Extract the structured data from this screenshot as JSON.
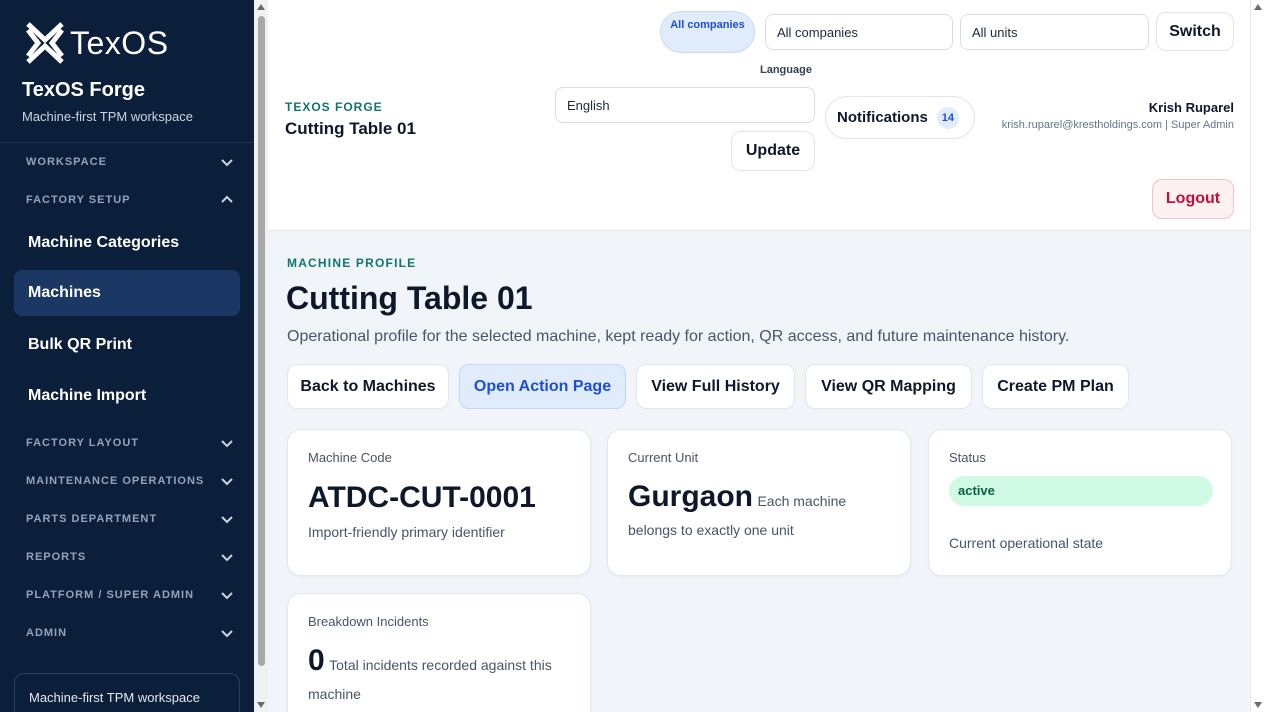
{
  "brand": {
    "logo_text": "TexOS",
    "title": "TexOS Forge",
    "subtitle": "Machine-first TPM workspace"
  },
  "sidebar": {
    "sections": [
      {
        "label": "WORKSPACE",
        "expanded": false
      },
      {
        "label": "FACTORY SETUP",
        "expanded": true
      },
      {
        "label": "FACTORY LAYOUT",
        "expanded": false
      },
      {
        "label": "MAINTENANCE OPERATIONS",
        "expanded": false
      },
      {
        "label": "PARTS DEPARTMENT",
        "expanded": false
      },
      {
        "label": "REPORTS",
        "expanded": false
      },
      {
        "label": "PLATFORM / SUPER ADMIN",
        "expanded": false
      },
      {
        "label": "ADMIN",
        "expanded": false
      }
    ],
    "factory_setup_items": [
      {
        "label": "Machine Categories",
        "active": false
      },
      {
        "label": "Machines",
        "active": true
      },
      {
        "label": "Bulk QR Print",
        "active": false
      },
      {
        "label": "Machine Import",
        "active": false
      }
    ],
    "footer_text": "Machine-first TPM workspace"
  },
  "header": {
    "eyebrow": "TEXOS FORGE",
    "title": "Cutting Table 01",
    "company_pill": "All companies",
    "company_select": "All companies",
    "unit_select": "All units",
    "switch_label": "Switch",
    "language_label": "Language",
    "language_value": "English",
    "update_label": "Update",
    "notifications_label": "Notifications",
    "notifications_count": "14",
    "user_name": "Krish Ruparel",
    "user_meta": "krish.ruparel@krestholdings.com | Super Admin",
    "logout_label": "Logout"
  },
  "main": {
    "eyebrow": "MACHINE PROFILE",
    "title": "Cutting Table 01",
    "description": "Operational profile for the selected machine, kept ready for action, QR access, and future maintenance history.",
    "actions": [
      {
        "label": "Back to Machines",
        "primary": false
      },
      {
        "label": "Open Action Page",
        "primary": true
      },
      {
        "label": "View Full History",
        "primary": false
      },
      {
        "label": "View QR Mapping",
        "primary": false
      },
      {
        "label": "Create PM Plan",
        "primary": false
      }
    ],
    "cards": {
      "machine_code": {
        "label": "Machine Code",
        "value": "ATDC-CUT-0001",
        "note": "Import-friendly primary identifier"
      },
      "current_unit": {
        "label": "Current Unit",
        "value": "Gurgaon",
        "note": "Each machine belongs to exactly one unit"
      },
      "status": {
        "label": "Status",
        "value": "active",
        "note": "Current operational state"
      },
      "breakdown": {
        "label": "Breakdown Incidents",
        "value": "0",
        "note": "Total incidents recorded against this machine"
      }
    }
  },
  "colors": {
    "sidebar_bg": "#0b1e3a",
    "active_nav": "#1b3763",
    "accent_teal": "#0f766e",
    "primary_blue": "#1d4ed8",
    "status_green_bg": "#d1fae5",
    "logout_red": "#be123c"
  }
}
